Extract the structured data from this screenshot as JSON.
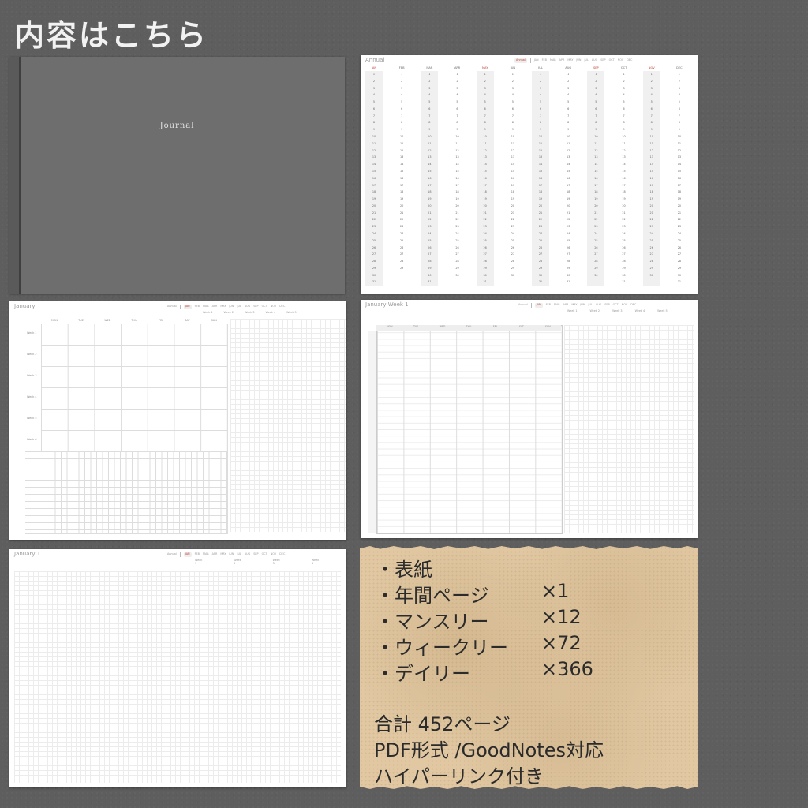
{
  "heading": "内容はこちら",
  "cover": {
    "title": "Journal"
  },
  "annual": {
    "title": "Annual",
    "nav": [
      "Annual",
      "JAN",
      "FEB",
      "MAR",
      "APR",
      "MAY",
      "JUN",
      "JUL",
      "AUG",
      "SEP",
      "OCT",
      "NOV",
      "DEC"
    ],
    "months": [
      "JAN",
      "FEB",
      "MAR",
      "APR",
      "MAY",
      "JUN",
      "JUL",
      "AUG",
      "SEP",
      "OCT",
      "NOV",
      "DEC"
    ],
    "month_days": [
      31,
      29,
      31,
      30,
      31,
      30,
      31,
      31,
      30,
      31,
      30,
      31
    ]
  },
  "monthly": {
    "title": "January",
    "nav": [
      "Annual",
      "JAN",
      "FEB",
      "MAR",
      "APR",
      "MAY",
      "JUN",
      "JUL",
      "AUG",
      "SEP",
      "OCT",
      "NOV",
      "DEC"
    ],
    "weeks_nav": [
      "Week 1",
      "Week 2",
      "Week 3",
      "Week 4",
      "Week 5"
    ],
    "days": [
      "MON",
      "TUE",
      "WED",
      "THU",
      "FRI",
      "SAT",
      "SUN"
    ],
    "weeks": [
      "Week 1",
      "Week 2",
      "Week 3",
      "Week 4",
      "Week 5",
      "Week 6"
    ]
  },
  "weekly": {
    "title": "January  Week 1",
    "nav": [
      "Annual",
      "JAN",
      "FEB",
      "MAR",
      "APR",
      "MAY",
      "JUN",
      "JUL",
      "AUG",
      "SEP",
      "OCT",
      "NOV",
      "DEC"
    ],
    "weeks_nav": [
      "Week 1",
      "Week 2",
      "Week 3",
      "Week 4",
      "Week 5"
    ],
    "days": [
      "MON",
      "TUE",
      "WED",
      "THU",
      "FRI",
      "SAT",
      "SUN"
    ]
  },
  "daily": {
    "title": "January  1",
    "nav": [
      "Annual",
      "JAN",
      "FEB",
      "MAR",
      "APR",
      "MAY",
      "JUN",
      "JUL",
      "AUG",
      "SEP",
      "OCT",
      "NOV",
      "DEC"
    ],
    "weeks_nav": [
      "Week 1",
      "Week 2",
      "Week 3",
      "Week 4",
      "Week 5"
    ]
  },
  "contents": {
    "items": [
      {
        "label": "・表紙",
        "count": ""
      },
      {
        "label": "・年間ページ",
        "count": "×1"
      },
      {
        "label": "・マンスリー",
        "count": "×12"
      },
      {
        "label": "・ウィークリー",
        "count": "×72"
      },
      {
        "label": "・デイリー",
        "count": "×366"
      }
    ],
    "total": "合計 452ページ",
    "format": "PDF形式 /GoodNotes対応",
    "hyperlink": "ハイパーリンク付き"
  },
  "colors": {
    "accent": "#c0392b",
    "background": "#5e5e5e",
    "card": "#e1c8a2",
    "cover": "#6e6e6e"
  }
}
